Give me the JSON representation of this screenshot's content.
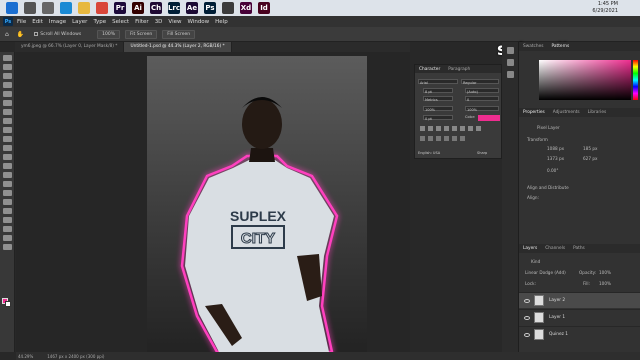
{
  "taskbar": {
    "time": "1:45 PM",
    "date": "6/29/2021",
    "apps": [
      {
        "name": "windows-icon",
        "color": "#1b6fd1",
        "label": ""
      },
      {
        "name": "search-icon",
        "color": "#555555",
        "label": ""
      },
      {
        "name": "task-view-icon",
        "color": "#666666",
        "label": ""
      },
      {
        "name": "edge-icon",
        "color": "#1a8ad4",
        "label": ""
      },
      {
        "name": "file-explorer-icon",
        "color": "#e7b83f",
        "label": ""
      },
      {
        "name": "chrome-icon",
        "color": "#d9473a",
        "label": ""
      },
      {
        "name": "premiere-icon",
        "color": "#1c0a3a",
        "label": "Pr"
      },
      {
        "name": "illustrator-icon",
        "color": "#330000",
        "label": "Ai"
      },
      {
        "name": "character-animator-icon",
        "color": "#1f0a33",
        "label": "Ch"
      },
      {
        "name": "lightroom-classic-icon",
        "color": "#001e36",
        "label": "Lrc"
      },
      {
        "name": "after-effects-icon",
        "color": "#1b0a33",
        "label": "Ae"
      },
      {
        "name": "photoshop-icon",
        "color": "#001e36",
        "label": "Ps"
      },
      {
        "name": "files-icon",
        "color": "#3c3c3c",
        "label": ""
      },
      {
        "name": "xd-icon",
        "color": "#470137",
        "label": "Xd"
      },
      {
        "name": "indesign-icon",
        "color": "#49021f",
        "label": "Id"
      }
    ]
  },
  "menubar": {
    "logo": "Ps",
    "items": [
      "File",
      "Edit",
      "Image",
      "Layer",
      "Type",
      "Select",
      "Filter",
      "3D",
      "View",
      "Window",
      "Help"
    ]
  },
  "optionsbar": {
    "scroll_all": "Scroll All Windows",
    "zoom": "100%",
    "fit_screen": "Fit Screen",
    "fill_screen": "Fill Screen"
  },
  "tabs": [
    {
      "label": "ym6.jpeg @ 66.7% (Layer 0, Layer Mask/8) *",
      "active": false
    },
    {
      "label": "Untitled-1.psd @ 44.3% (Layer 2, RGB/16) *",
      "active": true
    }
  ],
  "photo": {
    "shirt_line1": "SUPLEX",
    "shirt_line2": "CITY",
    "glow_color": "#ff3fbf"
  },
  "status": {
    "zoom": "44.29%",
    "size": "1467 px x 2400 px (300 ppi)"
  },
  "overlay": {
    "subscribe": "subscribe"
  },
  "character_panel": {
    "tabs": [
      "Character",
      "Paragraph"
    ],
    "font": "Arial",
    "style": "Regular",
    "size": "8 pt",
    "leading": "(Auto)",
    "kerning": "Metrics",
    "tracking": "0",
    "vscale": "100%",
    "hscale": "100%",
    "baseline": "0 pt",
    "color_label": "Color:",
    "color": "#ee2d8f",
    "language": "English: USA",
    "aa": "Sharp"
  },
  "right_panel": {
    "top_tabs": [
      "Swatches",
      "Patterns"
    ],
    "props_tabs": [
      "Properties",
      "Adjustments",
      "Libraries"
    ],
    "pixel_layer": "Pixel Layer",
    "transform_title": "Transform",
    "w": "1088 px",
    "h": "1373 px",
    "x": "185 px",
    "y": "627 px",
    "angle": "0.00°",
    "align_title": "Align and Distribute",
    "align_label": "Align:",
    "layers_tabs": [
      "Layers",
      "Channels",
      "Paths"
    ],
    "kind": "Kind",
    "blend": "Linear Dodge (Add)",
    "opacity_label": "Opacity:",
    "opacity": "100%",
    "lock_label": "Lock:",
    "fill_label": "Fill:",
    "fill": "100%",
    "layers": [
      {
        "name": "Layer 2",
        "selected": true
      },
      {
        "name": "Layer 1",
        "selected": false
      },
      {
        "name": "Quinez 1",
        "selected": false
      }
    ]
  }
}
